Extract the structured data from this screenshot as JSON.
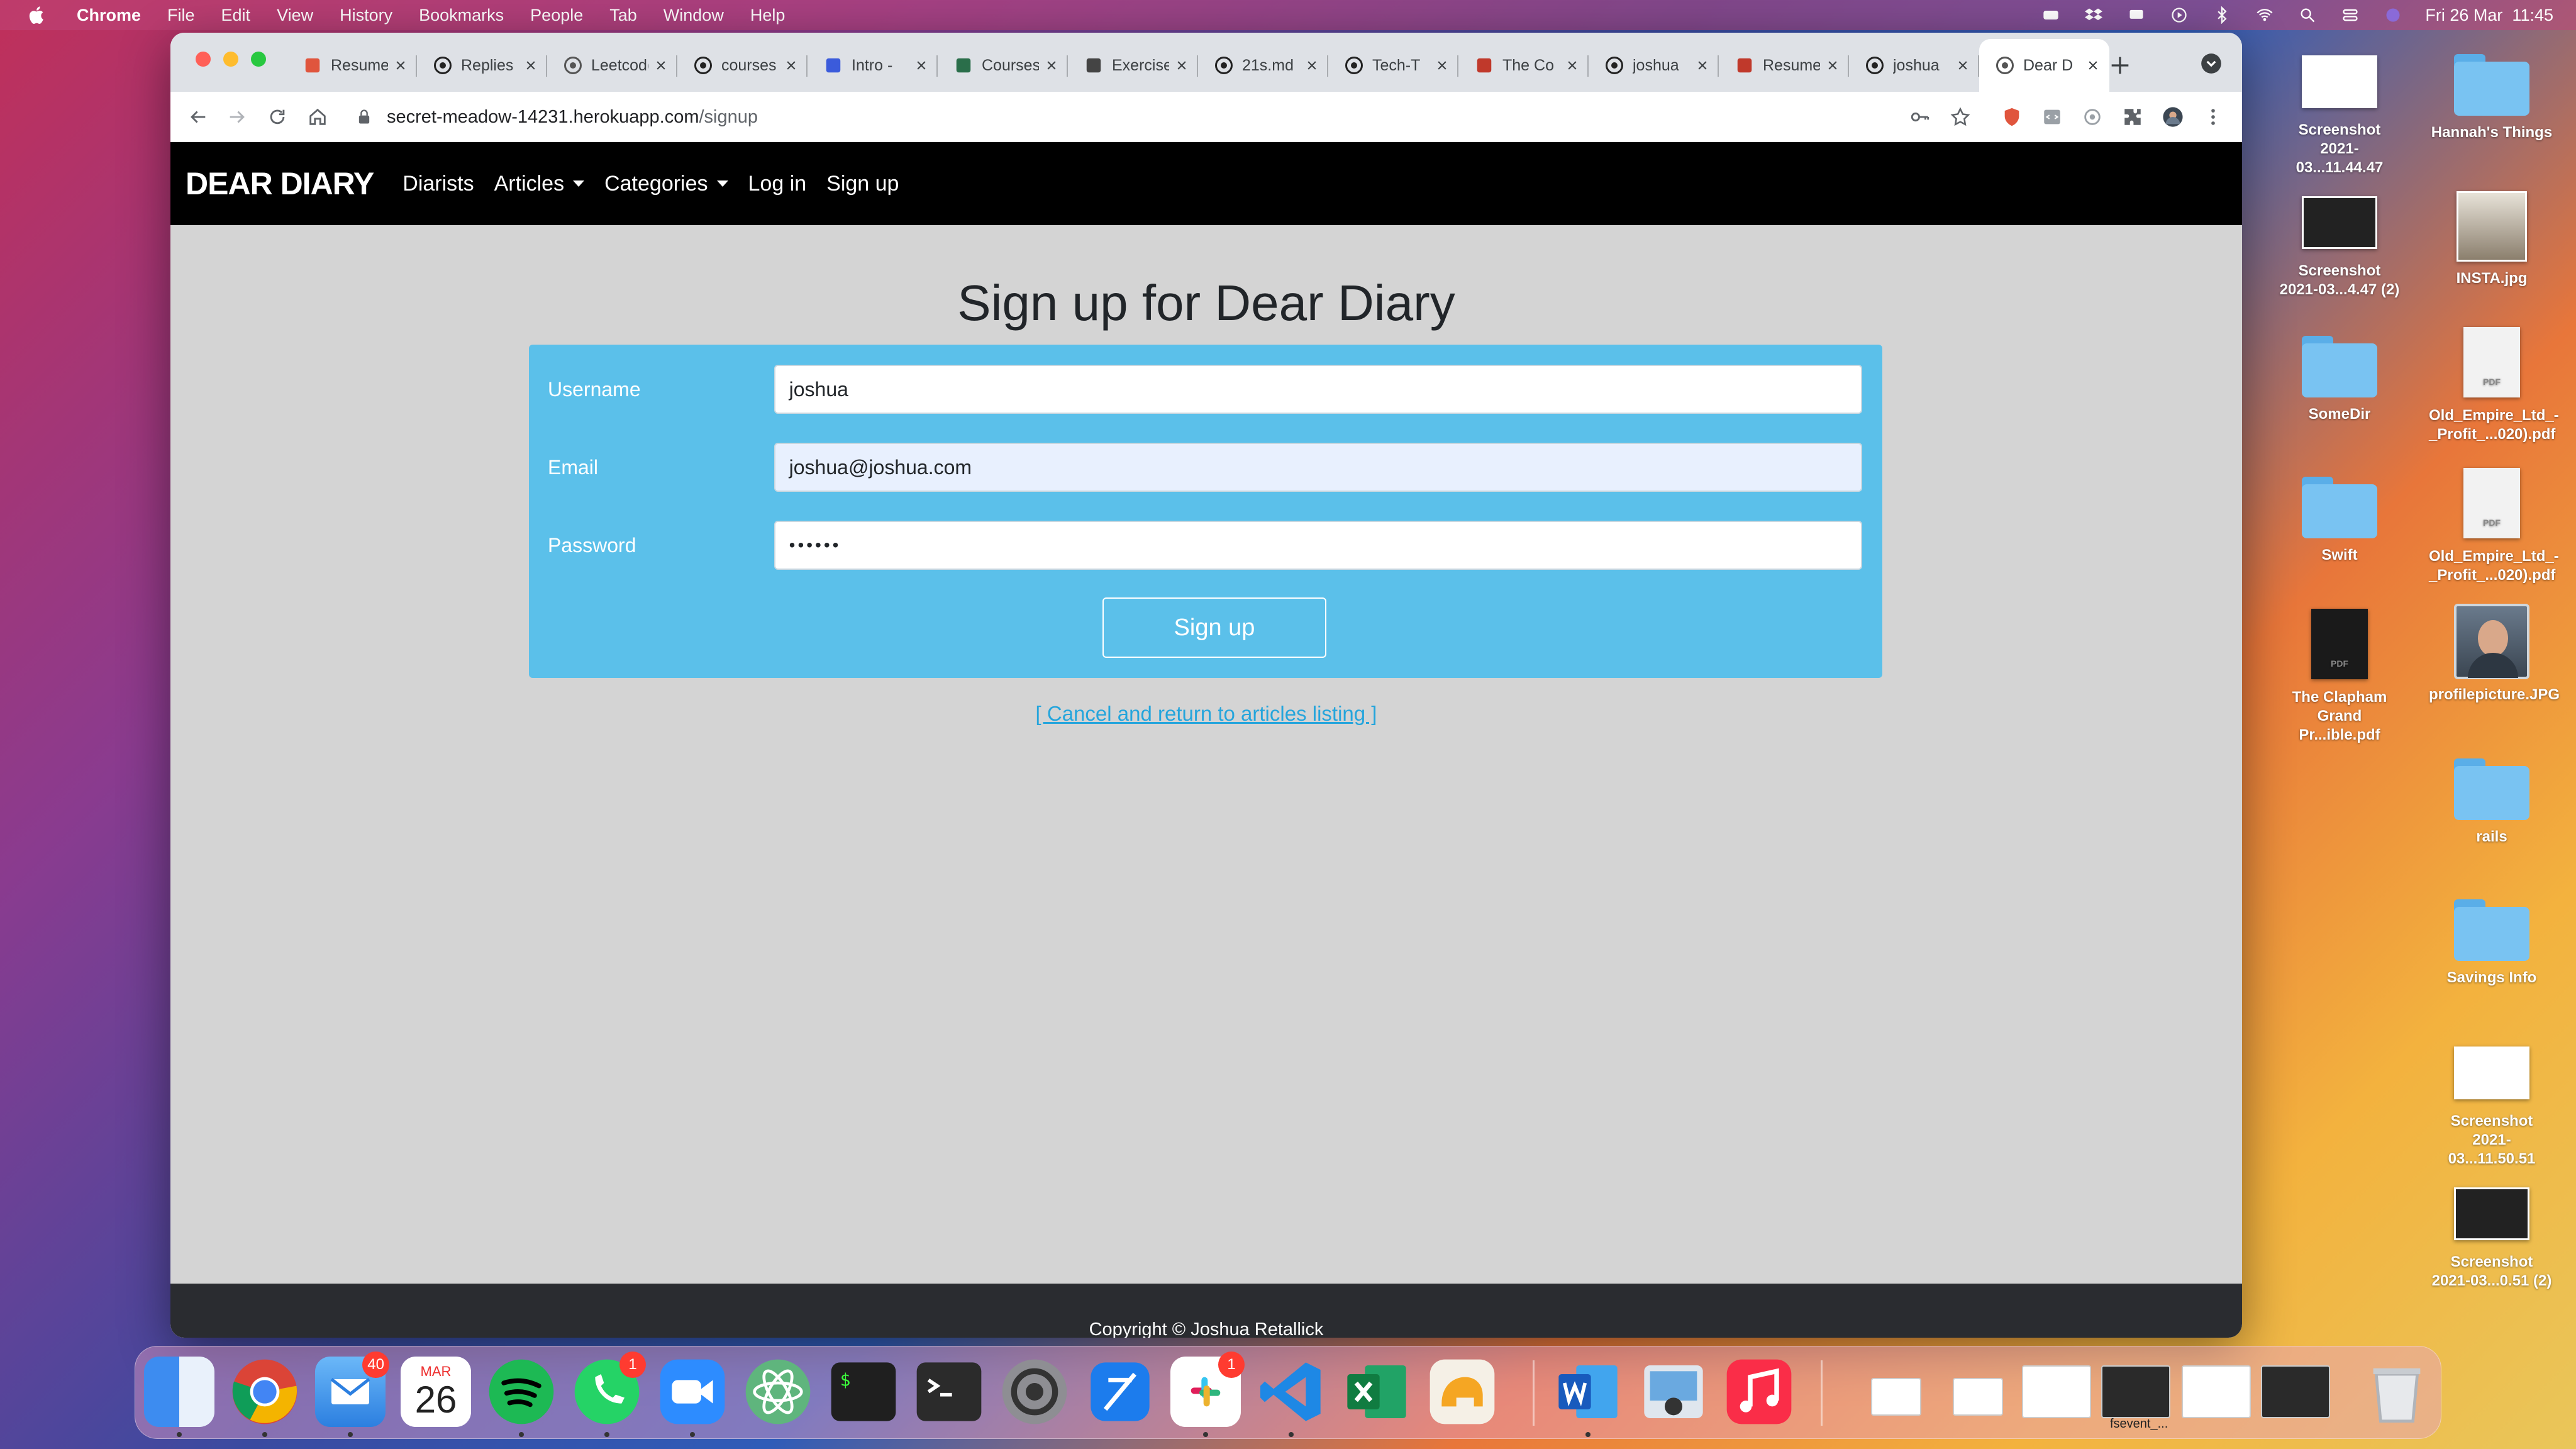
{
  "menubar": {
    "app_name": "Chrome",
    "items": [
      "File",
      "Edit",
      "View",
      "History",
      "Bookmarks",
      "People",
      "Tab",
      "Window",
      "Help"
    ],
    "clock": "Fri 26 Mar  11:45"
  },
  "browser": {
    "tabs": [
      {
        "title": "Resume",
        "icon": "s-logo-icon"
      },
      {
        "title": "Replies",
        "icon": "github-icon"
      },
      {
        "title": "Leetcode",
        "icon": "globe-icon"
      },
      {
        "title": "courses",
        "icon": "github-icon"
      },
      {
        "title": "Intro -",
        "icon": "flag-icon"
      },
      {
        "title": "Courses",
        "icon": "course-icon"
      },
      {
        "title": "Exercise",
        "icon": "code-braces-icon"
      },
      {
        "title": "21s.md",
        "icon": "github-icon"
      },
      {
        "title": "Tech-T",
        "icon": "github-icon"
      },
      {
        "title": "The Co",
        "icon": "wave-icon"
      },
      {
        "title": "joshua",
        "icon": "github-icon"
      },
      {
        "title": "Resume",
        "icon": "red-square-icon"
      },
      {
        "title": "joshua",
        "icon": "github-icon"
      },
      {
        "title": "Dear D",
        "icon": "globe-icon",
        "active": true
      }
    ],
    "url_host": "secret-meadow-14231.herokuapp.com",
    "url_path": "/signup"
  },
  "site": {
    "brand": "DEAR DIARY",
    "nav": {
      "diarists": "Diarists",
      "articles": "Articles",
      "categories": "Categories",
      "login": "Log in",
      "signup": "Sign up"
    },
    "heading": "Sign up for Dear Diary",
    "form": {
      "username_label": "Username",
      "username_value": "joshua",
      "email_label": "Email",
      "email_value": "joshua@joshua.com",
      "password_label": "Password",
      "password_value": "••••••",
      "submit_label": "Sign up"
    },
    "cancel_link": "[ Cancel and return to articles listing ]",
    "footer": "Copyright © Joshua Retallick"
  },
  "desktop": {
    "icons": [
      {
        "label": "Screenshot\n2021-03...11.44.47",
        "kind": "screenshot"
      },
      {
        "label": "Hannah's Things",
        "kind": "folder"
      },
      {
        "label": "Screenshot\n2021-03...4.47 (2)",
        "kind": "screenshot"
      },
      {
        "label": "INSTA.jpg",
        "kind": "image"
      },
      {
        "label": "SomeDir",
        "kind": "folder"
      },
      {
        "label": "Old_Empire_Ltd_-\n_Profit_...020).pdf",
        "kind": "pdf"
      },
      {
        "label": "Swift",
        "kind": "folder"
      },
      {
        "label": "Old_Empire_Ltd_-\n_Profit_...020).pdf",
        "kind": "pdf"
      },
      {
        "label": "The Clapham\nGrand Pr...ible.pdf",
        "kind": "pdf"
      },
      {
        "label": "profilepicture.JPG",
        "kind": "photo"
      },
      {
        "label": "rails",
        "kind": "folder"
      },
      {
        "label": "Savings Info",
        "kind": "folder"
      },
      {
        "label": "Screenshot\n2021-03...11.50.51",
        "kind": "screenshot"
      },
      {
        "label": "Screenshot\n2021-03...0.51 (2)",
        "kind": "screenshot"
      }
    ]
  },
  "dock": {
    "mail_badge": "40",
    "calendar_month": "MAR",
    "calendar_day": "26",
    "whatsapp_badge": "1",
    "slack_badge": "1",
    "fsevent_label": "fsevent_..."
  },
  "colors": {
    "navbar": "#000000",
    "page_bg": "#d4d4d4",
    "form_bg": "#5bc0ea",
    "footer": "#2a2c30",
    "link": "#25a5dc"
  }
}
